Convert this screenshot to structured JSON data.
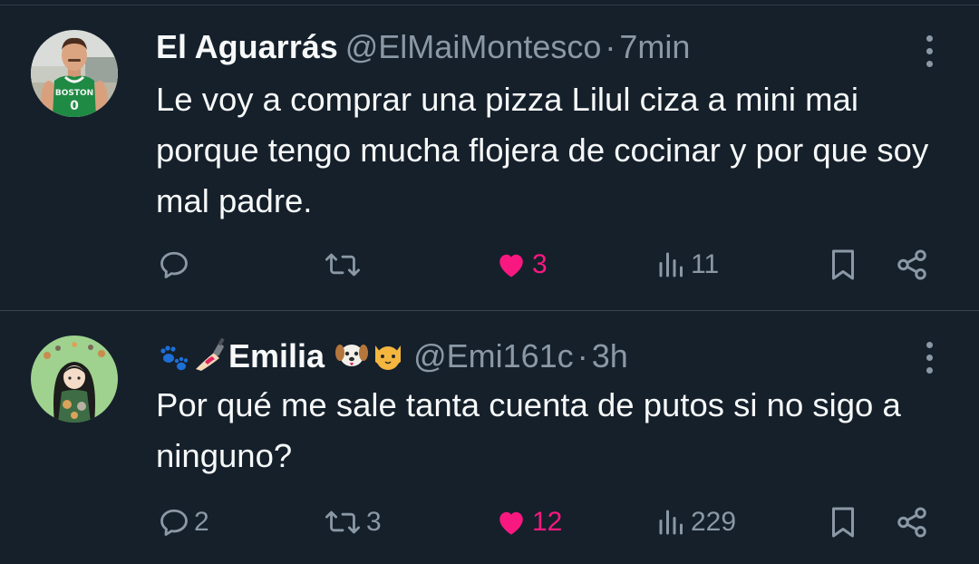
{
  "tweets": [
    {
      "display_name": "El Aguarrás",
      "handle": "@ElMaiMontesco",
      "separator": "·",
      "time": "7min",
      "text": "Le voy a comprar una pizza Lilul ciza a mini mai porque tengo mucha flojera de cocinar y por que soy mal padre.",
      "avatar_jersey_text": "BOSTON",
      "avatar_jersey_number": "0",
      "replies": "",
      "retweets": "",
      "likes": "3",
      "views": "11",
      "liked": true
    },
    {
      "display_name": "Emilia",
      "handle": "@Emi161c",
      "separator": "·",
      "time": "3h",
      "text": "Por qué me sale tanta cuenta de putos si no sigo a ninguno?",
      "replies": "2",
      "retweets": "3",
      "likes": "12",
      "views": "229",
      "liked": true,
      "name_emojis_before": [
        "paw-prints-emoji",
        "nail-polish-emoji"
      ],
      "name_emojis_after": [
        "dog-face-emoji",
        "cat-face-emoji"
      ]
    }
  ],
  "colors": {
    "background": "#15202b",
    "text": "#f7f9f9",
    "secondary": "#8b98a5",
    "like": "#f91880",
    "divider": "#38444d"
  },
  "icons": [
    "reply-icon",
    "retweet-icon",
    "heart-icon",
    "views-icon",
    "bookmark-icon",
    "share-icon",
    "more-icon"
  ]
}
